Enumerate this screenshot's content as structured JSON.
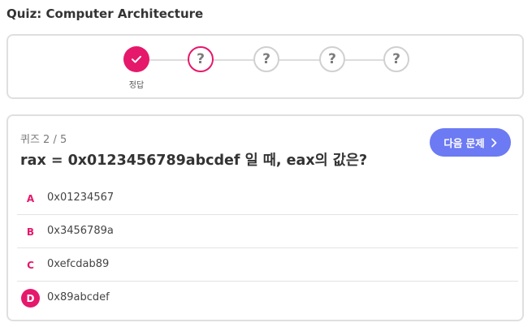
{
  "header": {
    "title": "Quiz: Computer Architecture"
  },
  "progress": {
    "steps": [
      {
        "state": "done",
        "icon": "check-icon",
        "label": "정답"
      },
      {
        "state": "current",
        "icon": "question-icon",
        "symbol": "?"
      },
      {
        "state": "pending",
        "icon": "question-icon",
        "symbol": "?"
      },
      {
        "state": "pending",
        "icon": "question-icon",
        "symbol": "?"
      },
      {
        "state": "pending",
        "icon": "question-icon",
        "symbol": "?"
      }
    ]
  },
  "quiz": {
    "counter": "퀴즈 2 / 5",
    "question": "rax = 0x0123456789abcdef 일 때, eax의 값은?",
    "next_label": "다음 문제",
    "next_icon": "chevron-right-icon",
    "options": [
      {
        "key": "A",
        "text": "0x01234567",
        "selected": false
      },
      {
        "key": "B",
        "text": "0x3456789a",
        "selected": false
      },
      {
        "key": "C",
        "text": "0xefcdab89",
        "selected": false
      },
      {
        "key": "D",
        "text": "0x89abcdef",
        "selected": true
      }
    ]
  },
  "colors": {
    "accent": "#e5186b",
    "button": "#6c7af3",
    "border": "#dfdfdf",
    "pending": "#d0d0d0"
  }
}
